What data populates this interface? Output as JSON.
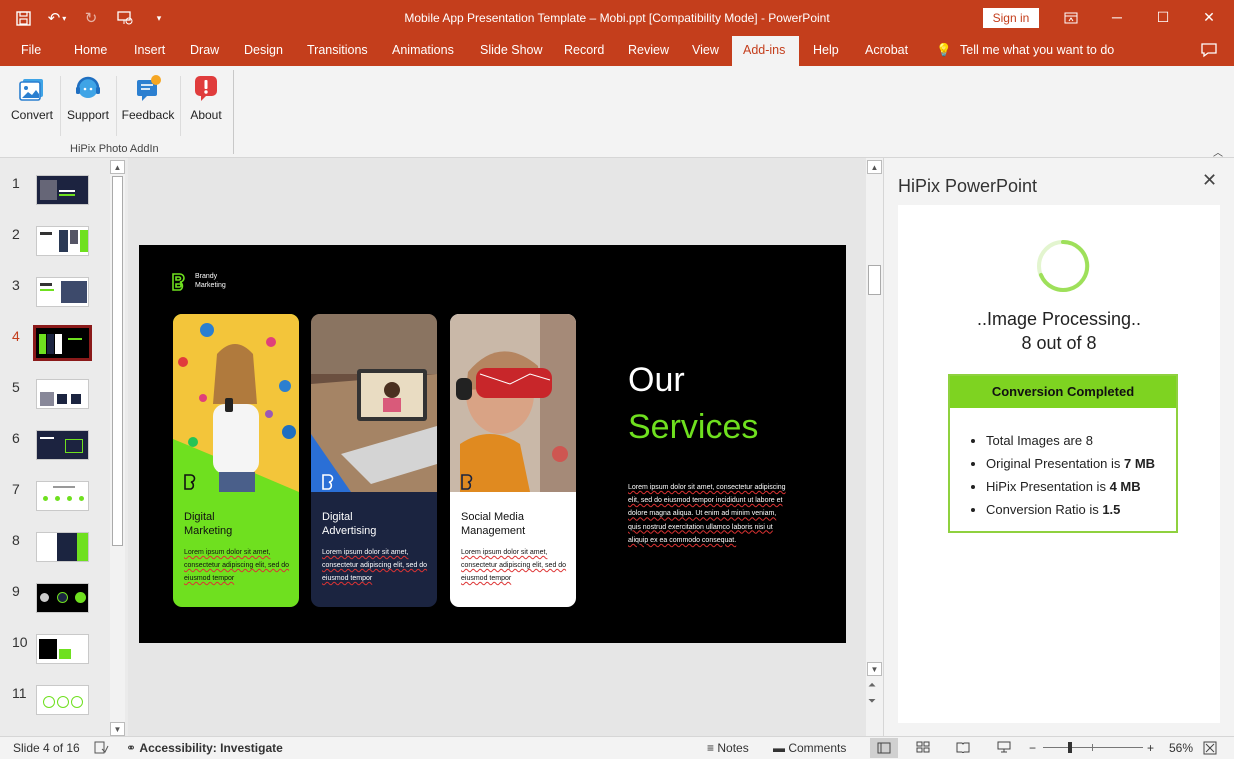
{
  "app": {
    "title": "Mobile App Presentation Template – Mobi.ppt [Compatibility Mode]  -  PowerPoint",
    "sign_in": "Sign in",
    "accent": "#c43e1c"
  },
  "tabs": [
    "File",
    "Home",
    "Insert",
    "Draw",
    "Design",
    "Transitions",
    "Animations",
    "Slide Show",
    "Record",
    "Review",
    "View",
    "Add-ins",
    "Help",
    "Acrobat"
  ],
  "active_tab": "Add-ins",
  "tell_me": "Tell me what you want to do",
  "ribbon": {
    "buttons": [
      "Convert",
      "Support",
      "Feedback",
      "About"
    ],
    "group_label": "HiPix Photo AddIn"
  },
  "thumbnails": [
    "1",
    "2",
    "3",
    "4",
    "5",
    "6",
    "7",
    "8",
    "9",
    "10",
    "11"
  ],
  "selected_slide": "4",
  "slide": {
    "brand_line1": "Brandy",
    "brand_line2": "Marketing",
    "cards": [
      {
        "title1": "Digital",
        "title2": "Marketing",
        "body": "Lorem ipsum dolor sit amet, consectetur adipiscing elit, sed do eiusmod tempor"
      },
      {
        "title1": "Digital",
        "title2": "Advertising",
        "body": "Lorem ipsum dolor sit amet, consectetur adipiscing elit, sed do eiusmod tempor"
      },
      {
        "title1": "Social Media",
        "title2": "Management",
        "body": "Lorem ipsum dolor sit amet, consectetur adipiscing elit, sed do eiusmod tempor"
      }
    ],
    "heading1": "Our",
    "heading2": "Services",
    "body": "Lorem ipsum dolor sit amet, consectetur adipiscing elit, sed do eiusmod tempor incididunt ut labore et dolore magna aliqua. Ut enim ad minim veniam, quis nostrud exercitation ullamco laboris nisi ut aliquip ex ea commodo consequat.",
    "green": "#6fe01f"
  },
  "pane": {
    "title": "HiPix PowerPoint",
    "processing": "..Image Processing..",
    "progress_text": "8 out of 8",
    "progress_fraction": 1.0,
    "result_title": "Conversion Completed",
    "items": [
      {
        "text": "Total Images are 8",
        "bold": ""
      },
      {
        "text": "Original Presentation is ",
        "bold": "7 MB"
      },
      {
        "text": "HiPix Presentation is ",
        "bold": "4 MB"
      },
      {
        "text": "Conversion Ratio is ",
        "bold": "1.5"
      }
    ]
  },
  "status": {
    "slide_counter": "Slide 4 of 16",
    "accessibility": "Accessibility: Investigate",
    "notes": "Notes",
    "comments": "Comments",
    "zoom": "56%"
  }
}
